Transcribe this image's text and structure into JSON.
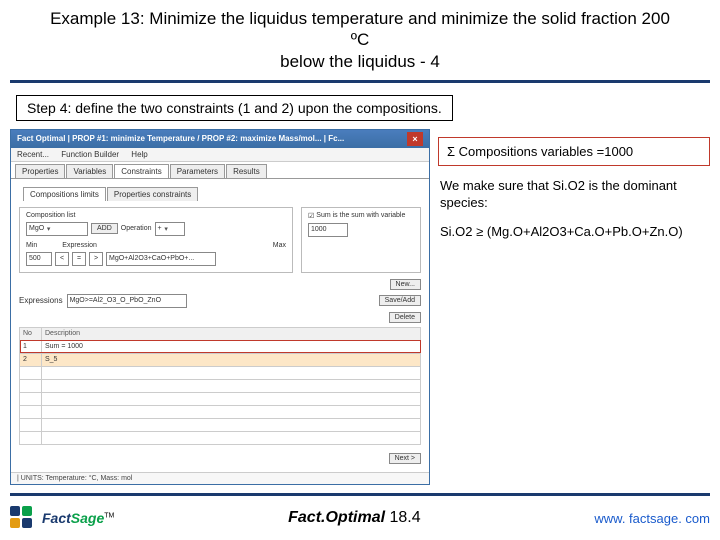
{
  "title": {
    "line1": "Example 13: Minimize the liquidus temperature and minimize the solid fraction 200 ºC",
    "line2": "below the liquidus - 4"
  },
  "step_box": "Step 4: define the two constraints (1 and 2) upon the compositions.",
  "screenshot": {
    "window_title": "Fact Optimal  | PROP #1: minimize Temperature / PROP #2: maximize Mass/mol... | Fc...",
    "menu": [
      "Recent...",
      "Function Builder",
      "Help"
    ],
    "tabs": [
      "Properties",
      "Variables",
      "Constraints",
      "Parameters",
      "Results"
    ],
    "active_tab": "Constraints",
    "sub_tabs": [
      "Compositions limits",
      "Properties constraints"
    ],
    "compo_label": "Composition list",
    "dropdown1": "MgO",
    "op_label": "Operation",
    "add_label": "ADD",
    "min_label": "Min",
    "max_label": "Max",
    "min_val": "500",
    "max_val": "-",
    "expr_lt": "<",
    "expr_eq": "=",
    "expr_gt": ">",
    "expr_box": "MgO+Al2O3+CaO+PbO+...",
    "expr_name": "Expression",
    "check1": "Sum is the sum with variable",
    "check1_val": "1000",
    "new_btn": "New...",
    "save_btn": "Save/Add",
    "delete_btn": "Delete",
    "properties_label": "Expressions",
    "expr_field": "MgO>=Al2_O3_O_PbO_ZnO",
    "th_no": "No",
    "th_desc": "Description",
    "row1_no": "1",
    "row1_desc": "Sum = 1000",
    "row2_no": "2",
    "row2_desc": "S_5",
    "next_btn": "Next >",
    "footer": "| UNITS:   Temperature: °C,  Mass: mol"
  },
  "annot": {
    "box1": "Σ Compositions variables =1000",
    "line2": "We make sure that Si.O2 is the dominant species:",
    "line3": "Si.O2 ≥ (Mg.O+Al2O3+Ca.O+Pb.O+Zn.O)"
  },
  "footer": {
    "logo_fact": "Fact",
    "logo_sage": "Sage",
    "logo_tm": "TM",
    "center_bold": "Fact.Optimal",
    "center_num": " 18.4",
    "url": "www. factsage. com"
  }
}
